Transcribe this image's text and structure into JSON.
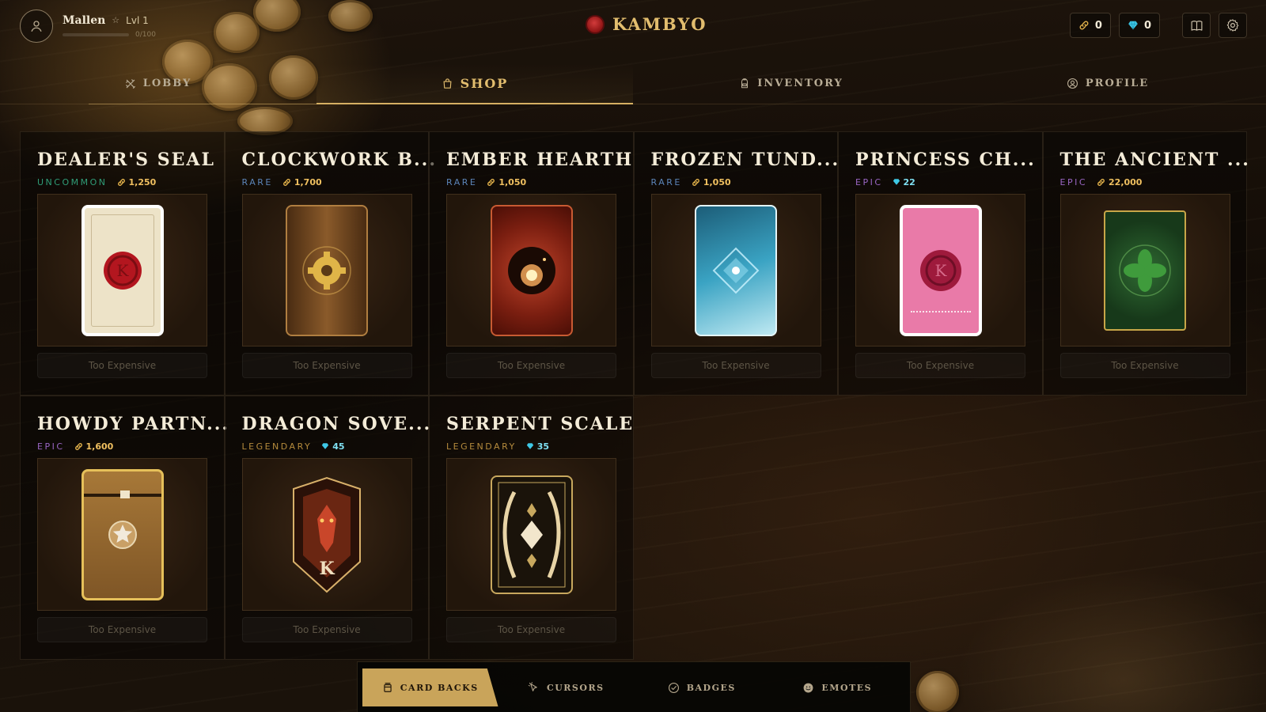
{
  "player": {
    "name": "Mallen",
    "level": "Lvl 1",
    "xp": "0/100",
    "xp_fraction": 0
  },
  "brand": {
    "name": "KAMBYO"
  },
  "currencies": [
    {
      "icon": "chain-coin-icon",
      "value": "0",
      "color": "#e0b04a"
    },
    {
      "icon": "diamond-icon",
      "value": "0",
      "color": "#3ec8e6"
    }
  ],
  "nav": [
    {
      "label": "LOBBY",
      "icon": "crossed-swords-icon",
      "active": false
    },
    {
      "label": "SHOP",
      "icon": "shopping-bag-icon",
      "active": true
    },
    {
      "label": "INVENTORY",
      "icon": "backpack-icon",
      "active": false
    },
    {
      "label": "PROFILE",
      "icon": "user-circle-icon",
      "active": false
    }
  ],
  "colors": {
    "gold": "#d6b063",
    "uncommon": "#2f9c77",
    "rare": "#5b84b8",
    "epic": "#9a66c4",
    "legendary": "#b48a3c"
  },
  "items": [
    {
      "title": "DEALER'S SEAL",
      "rarity": "UNCOMMON",
      "currency": "chain",
      "price": "1,250",
      "action": "Too Expensive"
    },
    {
      "title": "CLOCKWORK B...",
      "rarity": "RARE",
      "currency": "chain",
      "price": "1,700",
      "action": "Too Expensive"
    },
    {
      "title": "EMBER HEARTH",
      "rarity": "RARE",
      "currency": "chain",
      "price": "1,050",
      "action": "Too Expensive"
    },
    {
      "title": "FROZEN TUND...",
      "rarity": "RARE",
      "currency": "chain",
      "price": "1,050",
      "action": "Too Expensive"
    },
    {
      "title": "PRINCESS CH...",
      "rarity": "EPIC",
      "currency": "diamond",
      "price": "22",
      "action": "Too Expensive"
    },
    {
      "title": "THE ANCIENT ...",
      "rarity": "EPIC",
      "currency": "chain",
      "price": "22,000",
      "action": "Too Expensive"
    },
    {
      "title": "HOWDY PARTN...",
      "rarity": "EPIC",
      "currency": "chain",
      "price": "1,600",
      "action": "Too Expensive"
    },
    {
      "title": "DRAGON SOVE...",
      "rarity": "LEGENDARY",
      "currency": "diamond",
      "price": "45",
      "action": "Too Expensive"
    },
    {
      "title": "SERPENT SCALE",
      "rarity": "LEGENDARY",
      "currency": "diamond",
      "price": "35",
      "action": "Too Expensive"
    }
  ],
  "categories": [
    {
      "label": "CARD BACKS",
      "icon": "cards-icon",
      "active": true
    },
    {
      "label": "CURSORS",
      "icon": "cursor-icon",
      "active": false
    },
    {
      "label": "BADGES",
      "icon": "badge-check-icon",
      "active": false
    },
    {
      "label": "EMOTES",
      "icon": "smile-icon",
      "active": false
    }
  ]
}
